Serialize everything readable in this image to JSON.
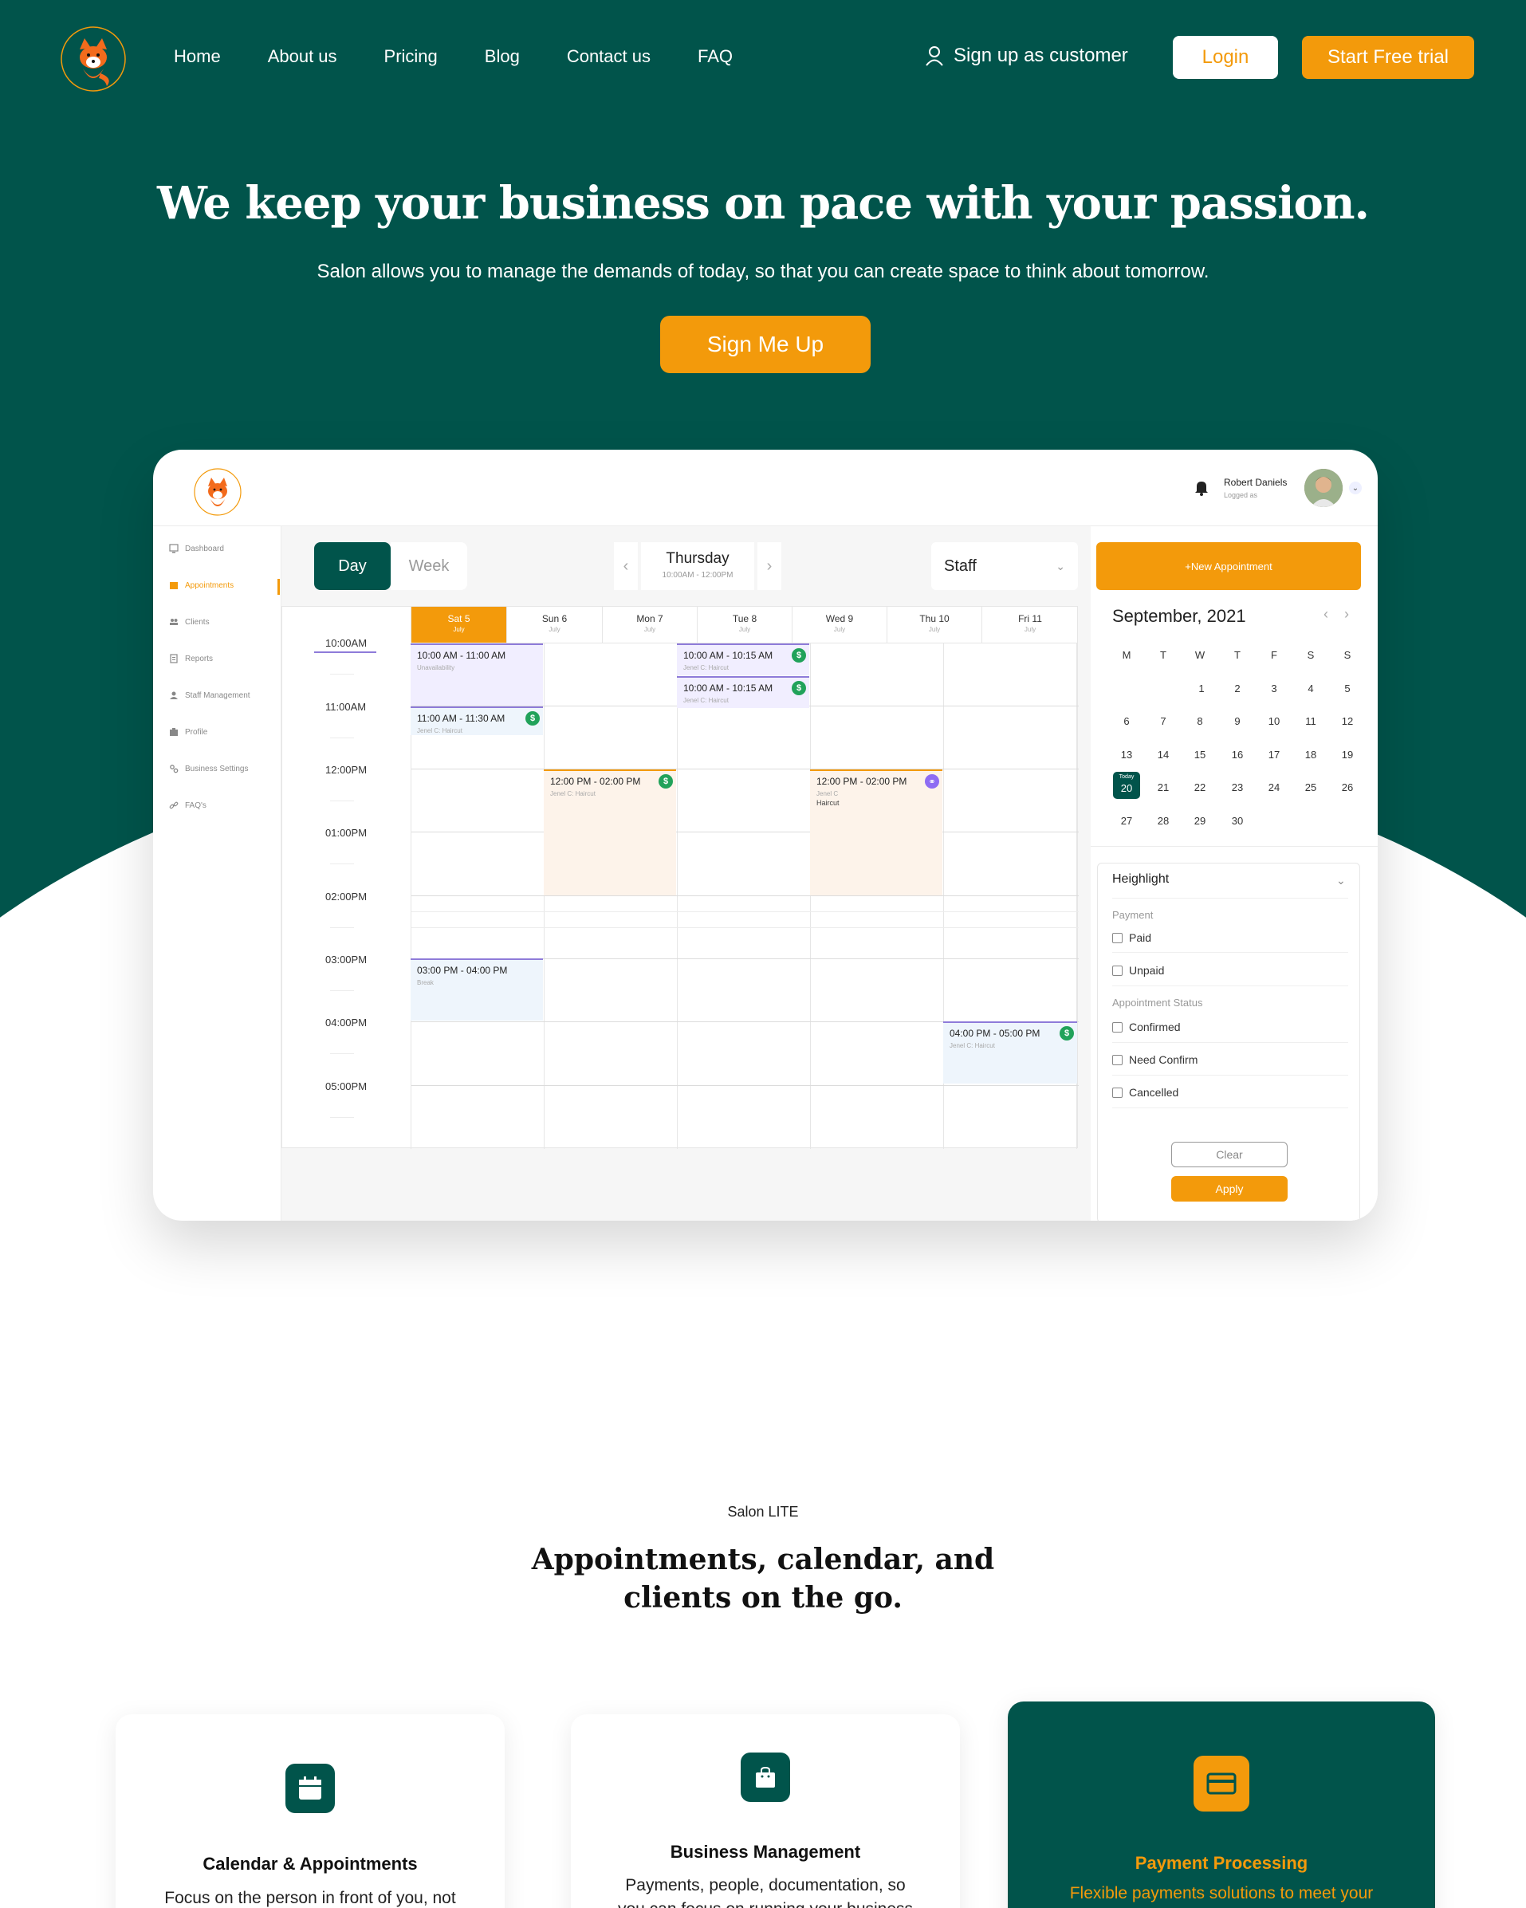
{
  "nav": {
    "logo_alt": "The Booking Fox",
    "links": [
      "Home",
      "About us",
      "Pricing",
      "Blog",
      "Contact us",
      "FAQ"
    ],
    "signup_customer": "Sign up as customer",
    "login": "Login",
    "start_trial": "Start Free trial"
  },
  "hero": {
    "title": "We keep your business on pace with your passion.",
    "subtitle": "Salon allows you to manage the demands of today, so that you can create space to think about tomorrow.",
    "cta": "Sign Me Up"
  },
  "dashboard": {
    "user": {
      "name": "Robert Daniels",
      "status": "Logged as"
    },
    "sidebar": [
      "Dashboard",
      "Appointments",
      "Clients",
      "Reports",
      "Staff Management",
      "Profile",
      "Business Settings",
      "FAQ's"
    ],
    "view_toggle": {
      "day": "Day",
      "week": "Week"
    },
    "date": {
      "day": "Thursday",
      "range": "10:00AM - 12:00PM"
    },
    "staff_select": "Staff",
    "new_appointment": "+New Appointment",
    "days": [
      {
        "name": "Sat 5",
        "month": "July"
      },
      {
        "name": "Sun 6",
        "month": "July"
      },
      {
        "name": "Mon 7",
        "month": "July"
      },
      {
        "name": "Tue 8",
        "month": "July"
      },
      {
        "name": "Wed 9",
        "month": "July"
      },
      {
        "name": "Thu 10",
        "month": "July"
      },
      {
        "name": "Fri 11",
        "month": "July"
      }
    ],
    "times": [
      "10:00AM",
      "11:00AM",
      "12:00PM",
      "01:00PM",
      "02:00PM",
      "03:00PM",
      "04:00PM",
      "05:00PM"
    ],
    "appointments": [
      {
        "time": "10:00 AM - 11:00 AM",
        "sub": "Unavailability"
      },
      {
        "time": "11:00 AM - 11:30 AM",
        "sub": "Jenel C: Haircut",
        "icon": "$"
      },
      {
        "time": "10:00 AM - 10:15 AM",
        "sub": "Jenel C: Haircut",
        "icon": "$"
      },
      {
        "time": "10:00 AM - 10:15 AM",
        "sub": "Jenel C: Haircut",
        "icon": "$"
      },
      {
        "time": "12:00 PM - 02:00 PM",
        "sub": "Jenel C: Haircut",
        "icon": "$"
      },
      {
        "time": "12:00 PM - 02:00 PM",
        "sub": "Jenel C",
        "sub2": "Haircut",
        "icon": "⚭"
      },
      {
        "time": "03:00 PM - 04:00 PM",
        "sub": "Break"
      },
      {
        "time": "04:00 PM - 05:00 PM",
        "sub": "Jenel C: Haircut",
        "icon": "$"
      }
    ],
    "mini_calendar": {
      "title": "September, 2021",
      "weekdays": [
        "M",
        "T",
        "W",
        "T",
        "F",
        "S",
        "S"
      ],
      "weeks": [
        [
          "",
          "",
          "1",
          "2",
          "3",
          "4",
          "5"
        ],
        [
          "6",
          "7",
          "8",
          "9",
          "10",
          "11",
          "12"
        ],
        [
          "13",
          "14",
          "15",
          "16",
          "17",
          "18",
          "19"
        ],
        [
          "20",
          "21",
          "22",
          "23",
          "24",
          "25",
          "26"
        ],
        [
          "27",
          "28",
          "29",
          "30",
          "",
          "",
          ""
        ]
      ],
      "today_label": "Today",
      "today": "20"
    },
    "highlight": {
      "title": "Heighlight",
      "payment_label": "Payment",
      "payment_options": [
        "Paid",
        "Unpaid"
      ],
      "status_label": "Appointment Status",
      "status_options": [
        "Confirmed",
        "Need Confirm",
        "Cancelled"
      ],
      "clear": "Clear",
      "apply": "Apply"
    }
  },
  "section": {
    "kicker": "Salon LITE",
    "title": "Appointments, calendar, and clients on the go."
  },
  "cards": [
    {
      "title": "Calendar & Appointments",
      "desc": "Focus on the person in front of you, not the work of planning",
      "icon": "calendar-icon"
    },
    {
      "title": "Business Management",
      "desc": "Payments, people, documentation, so you can focus on running your business",
      "icon": "bag-icon"
    },
    {
      "title": "Payment Processing",
      "desc": "Flexible payments solutions to meet your needs",
      "icon": "card-icon"
    }
  ],
  "colors": {
    "brand_green": "#01544b",
    "accent_orange": "#f39a0b"
  }
}
